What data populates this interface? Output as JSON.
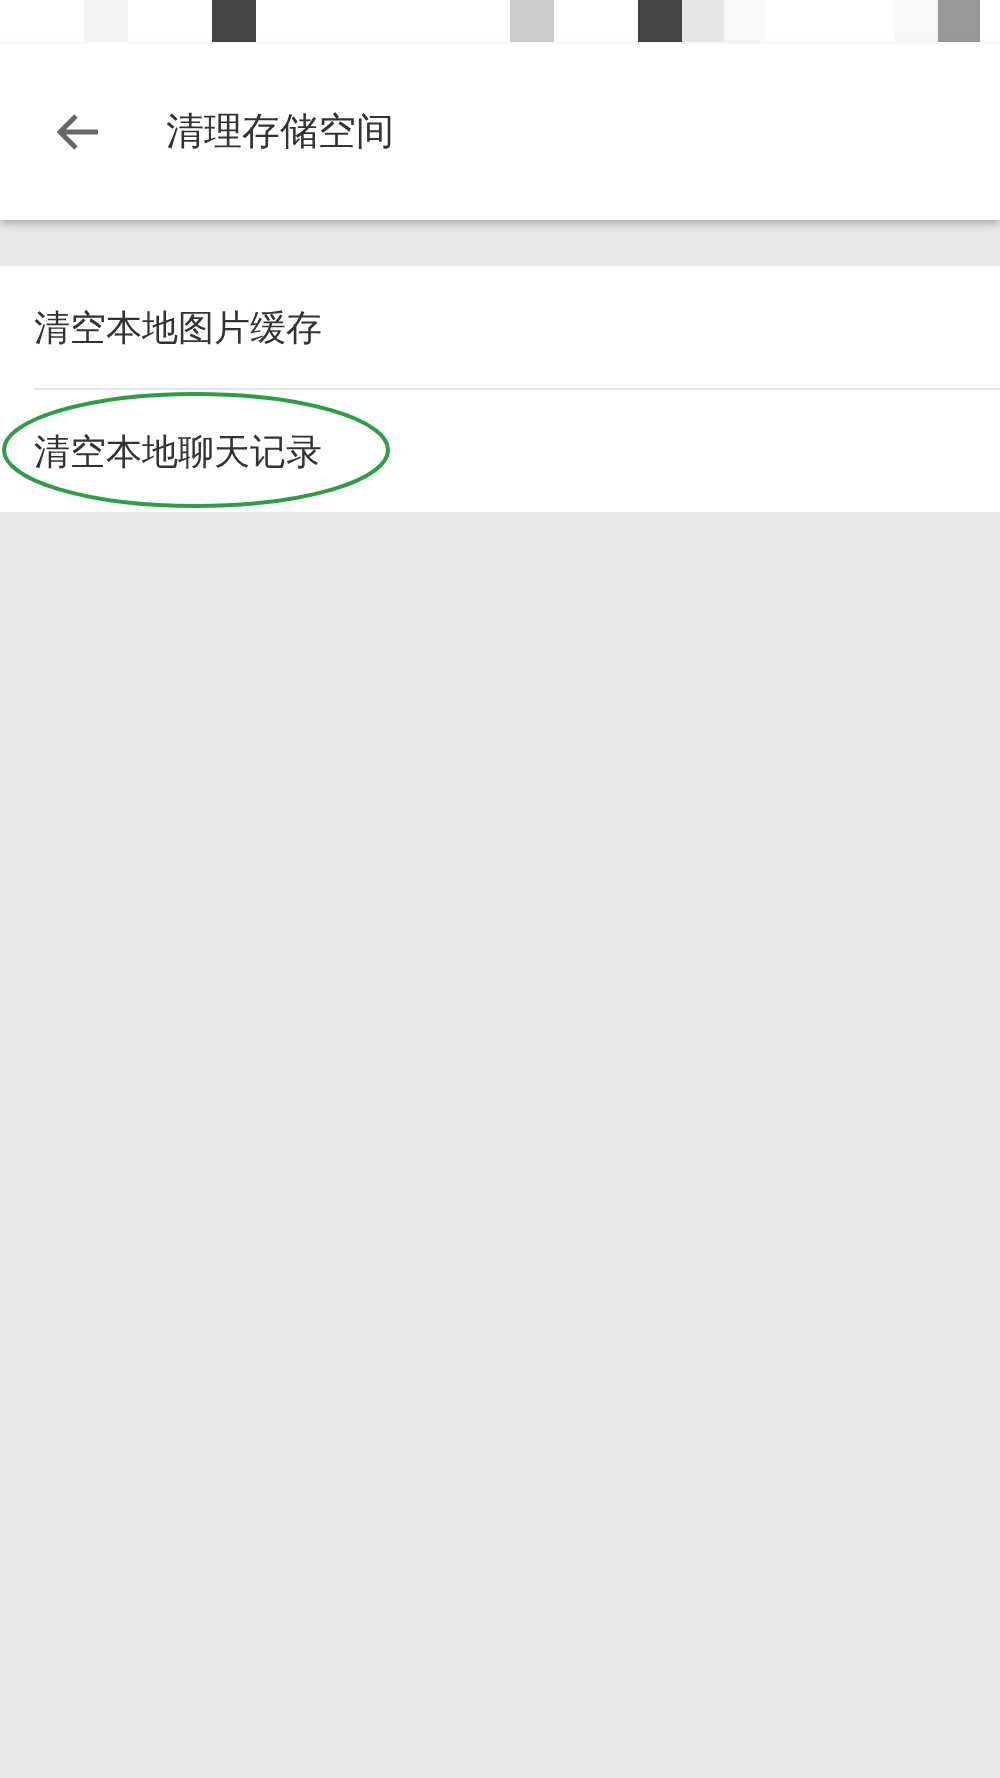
{
  "header": {
    "title": "清理存储空间"
  },
  "items": [
    {
      "label": "清空本地图片缓存",
      "circled": false
    },
    {
      "label": "清空本地聊天记录",
      "circled": true
    }
  ]
}
